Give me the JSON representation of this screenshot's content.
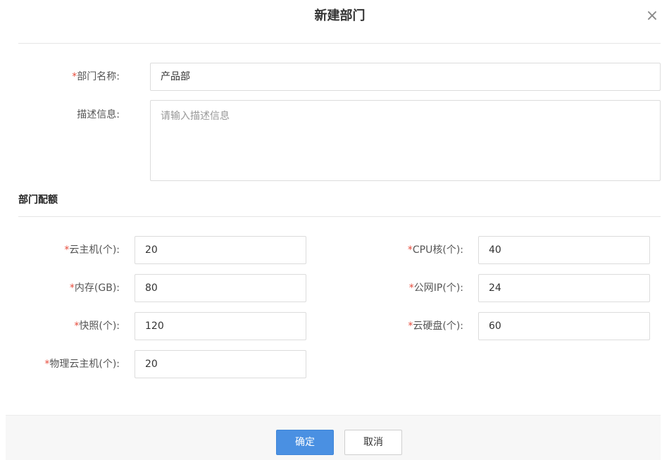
{
  "dialog": {
    "title": "新建部门",
    "close_icon": "×"
  },
  "form": {
    "name": {
      "label": "部门名称:",
      "required_mark": "*",
      "value": "产品部"
    },
    "description": {
      "label": "描述信息:",
      "placeholder": "请输入描述信息",
      "value": ""
    }
  },
  "quota": {
    "section_title": "部门配额",
    "cloud_host": {
      "label": "云主机(个):",
      "required_mark": "*",
      "value": "20"
    },
    "cpu": {
      "label": "CPU核(个):",
      "required_mark": "*",
      "value": "40"
    },
    "memory": {
      "label": "内存(GB):",
      "required_mark": "*",
      "value": "80"
    },
    "public_ip": {
      "label": "公网IP(个):",
      "required_mark": "*",
      "value": "24"
    },
    "snapshot": {
      "label": "快照(个):",
      "required_mark": "*",
      "value": "120"
    },
    "cloud_disk": {
      "label": "云硬盘(个):",
      "required_mark": "*",
      "value": "60"
    },
    "physical_host": {
      "label": "物理云主机(个):",
      "required_mark": "*",
      "value": "20"
    }
  },
  "footer": {
    "confirm_label": "确定",
    "cancel_label": "取消"
  },
  "colors": {
    "primary": "#4a90e2",
    "required": "#e74c3c"
  }
}
